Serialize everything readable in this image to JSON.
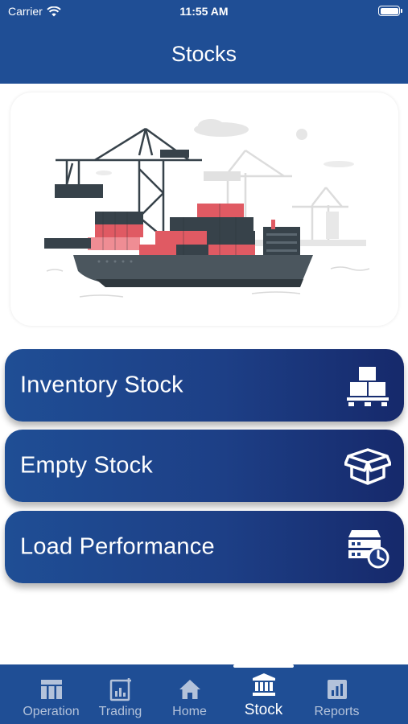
{
  "status_bar": {
    "carrier": "Carrier",
    "time": "11:55 AM"
  },
  "header": {
    "title": "Stocks"
  },
  "menu": [
    {
      "label": "Inventory Stock",
      "icon": "pallet-boxes-icon"
    },
    {
      "label": "Empty Stock",
      "icon": "open-box-icon"
    },
    {
      "label": "Load Performance",
      "icon": "server-clock-icon"
    }
  ],
  "tabs": [
    {
      "label": "Operation",
      "icon": "table-icon",
      "active": false
    },
    {
      "label": "Trading",
      "icon": "chart-board-icon",
      "active": false
    },
    {
      "label": "Home",
      "icon": "home-icon",
      "active": false
    },
    {
      "label": "Stock",
      "icon": "bank-icon",
      "active": true
    },
    {
      "label": "Reports",
      "icon": "bar-chart-icon",
      "active": false
    }
  ],
  "colors": {
    "primary": "#1f4e95",
    "gradient_end": "#16296b",
    "container_red": "#e05a63",
    "container_dark": "#37424a"
  }
}
